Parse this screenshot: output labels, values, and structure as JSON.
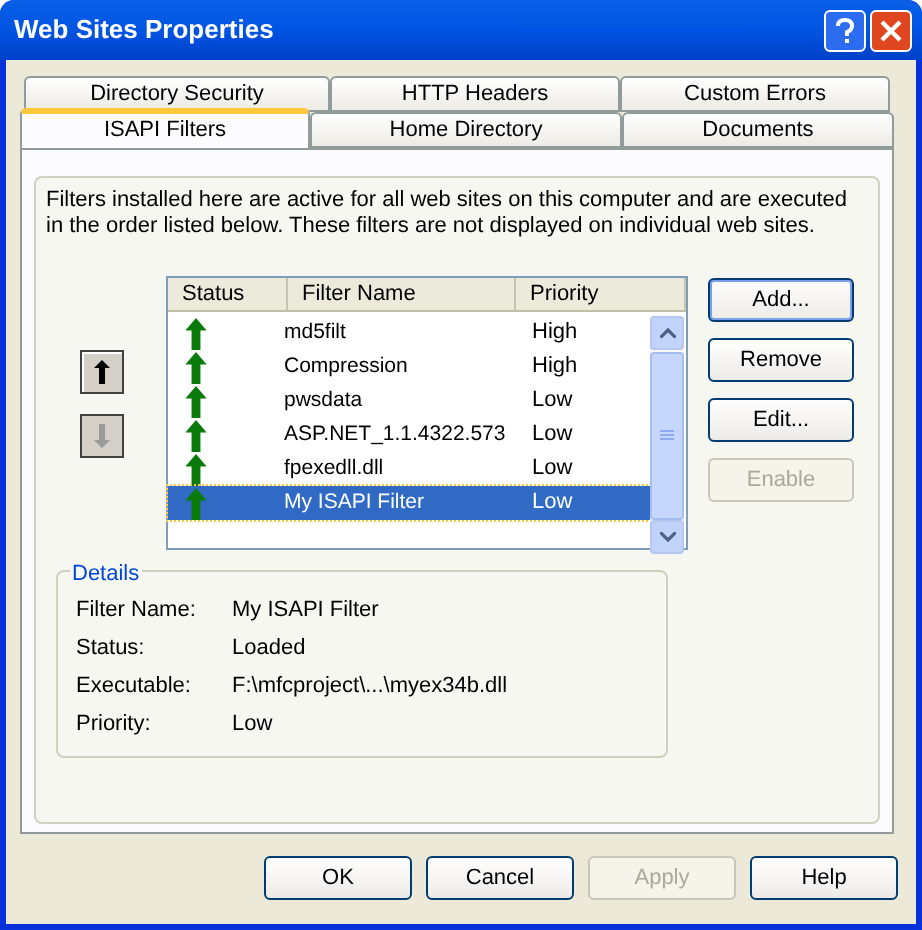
{
  "window": {
    "title": "Web Sites Properties"
  },
  "tab_rows": [
    [
      {
        "label": "Directory Security",
        "selected": false
      },
      {
        "label": "HTTP Headers",
        "selected": false
      },
      {
        "label": "Custom Errors",
        "selected": false
      }
    ],
    [
      {
        "label": "ISAPI Filters",
        "selected": true
      },
      {
        "label": "Home Directory",
        "selected": false
      },
      {
        "label": "Documents",
        "selected": false
      }
    ]
  ],
  "description": "Filters installed here are active for all web sites on this computer and are executed in the order listed below.  These filters are not displayed on individual web sites.",
  "move_buttons": [
    {
      "kind": "up",
      "disabled": false
    },
    {
      "kind": "down",
      "disabled": true
    }
  ],
  "filters": {
    "columns": [
      "Status",
      "Filter Name",
      "Priority"
    ],
    "rows": [
      {
        "name": "md5filt",
        "priority": "High",
        "selected": false
      },
      {
        "name": "Compression",
        "priority": "High",
        "selected": false
      },
      {
        "name": "pwsdata",
        "priority": "Low",
        "selected": false
      },
      {
        "name": "ASP.NET_1.1.4322.573",
        "priority": "Low",
        "selected": false
      },
      {
        "name": "fpexedll.dll",
        "priority": "Low",
        "selected": false
      },
      {
        "name": "My ISAPI Filter",
        "priority": "Low",
        "selected": true
      }
    ]
  },
  "side_buttons": [
    {
      "label": "Add...",
      "disabled": false,
      "default": true
    },
    {
      "label": "Remove",
      "disabled": false,
      "default": false
    },
    {
      "label": "Edit...",
      "disabled": false,
      "default": false
    },
    {
      "label": "Enable",
      "disabled": true,
      "default": false
    }
  ],
  "details": {
    "title": "Details",
    "fields": [
      {
        "label": "Filter Name:",
        "value": "My ISAPI Filter"
      },
      {
        "label": "Status:",
        "value": "Loaded"
      },
      {
        "label": "Executable:",
        "value": "F:\\mfcproject\\...\\myex34b.dll"
      },
      {
        "label": "Priority:",
        "value": "Low"
      }
    ]
  },
  "footer_buttons": [
    {
      "label": "OK",
      "disabled": false
    },
    {
      "label": "Cancel",
      "disabled": false
    },
    {
      "label": "Apply",
      "disabled": true
    },
    {
      "label": "Help",
      "disabled": false
    }
  ]
}
